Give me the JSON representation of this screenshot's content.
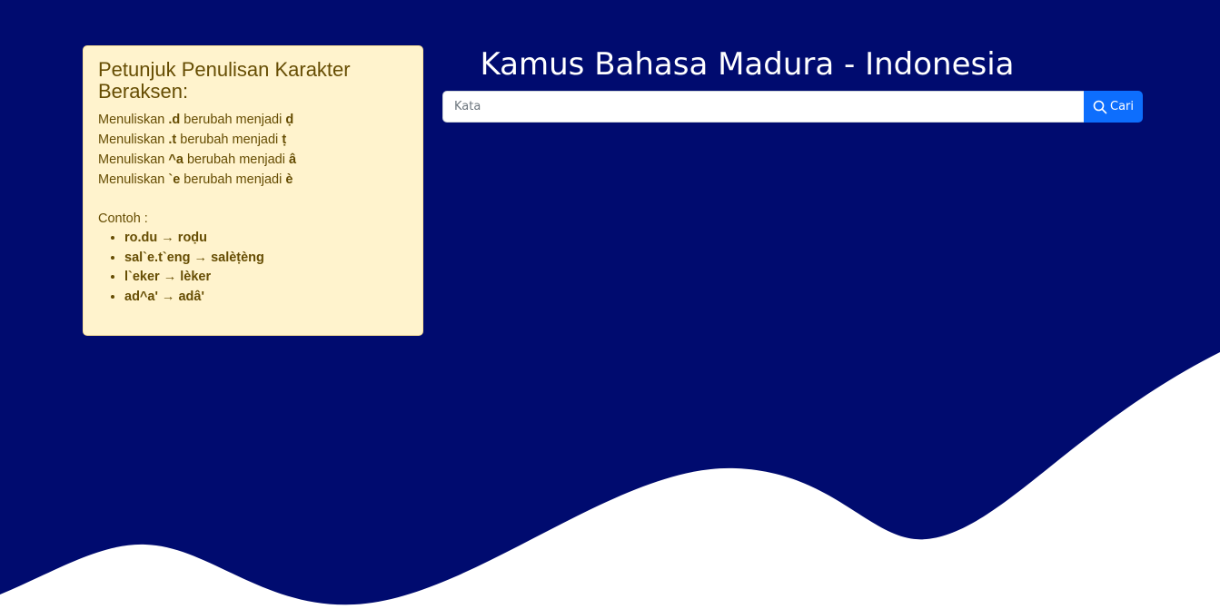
{
  "page": {
    "title": "Kamus Bahasa Madura - Indonesia"
  },
  "colors": {
    "background_navy": "#000b6f",
    "wave_white": "#ffffff",
    "card_bg": "#fff3cd",
    "card_text": "#664d03",
    "button_blue": "#0d6efd"
  },
  "help": {
    "title": "Petunjuk Penulisan Karakter Beraksen:",
    "rules": [
      {
        "prefix": "Menuliskan ",
        "input": ".d",
        "middle": " berubah menjadi ",
        "output": "ḍ"
      },
      {
        "prefix": "Menuliskan ",
        "input": ".t",
        "middle": " berubah menjadi ",
        "output": "ṭ"
      },
      {
        "prefix": "Menuliskan ",
        "input": "^a",
        "middle": " berubah menjadi ",
        "output": "â"
      },
      {
        "prefix": "Menuliskan ",
        "input": "`e",
        "middle": " berubah menjadi ",
        "output": "è"
      }
    ],
    "examples_label": "Contoh :",
    "examples": [
      "ro.du → roḍu",
      "sal`e.t`eng → salèṭèng",
      "l`eker → lèker",
      "ad^a' → adâ'"
    ]
  },
  "search": {
    "placeholder": "Kata",
    "value": "",
    "button_label": "Cari",
    "button_icon": "search-icon"
  }
}
